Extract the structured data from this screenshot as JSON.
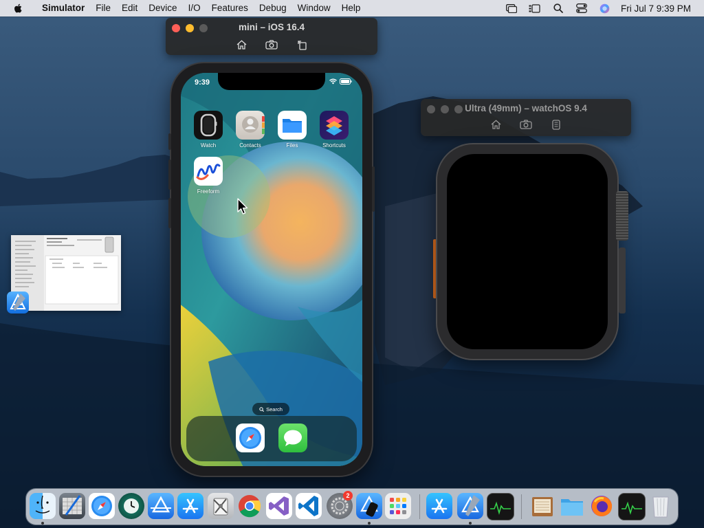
{
  "menubar": {
    "items": [
      "Simulator",
      "File",
      "Edit",
      "Device",
      "I/O",
      "Features",
      "Debug",
      "Window",
      "Help"
    ],
    "clock": "Fri Jul 7  9:39 PM"
  },
  "iphone_sim": {
    "title": "mini – iOS 16.4",
    "status_time": "9:39",
    "apps": [
      {
        "label": "Watch",
        "icon": "watch-app-icon"
      },
      {
        "label": "Contacts",
        "icon": "contacts-app-icon"
      },
      {
        "label": "Files",
        "icon": "files-app-icon"
      },
      {
        "label": "Shortcuts",
        "icon": "shortcuts-app-icon"
      },
      {
        "label": "Freeform",
        "icon": "freeform-app-icon"
      }
    ],
    "search_label": "Search",
    "dock": [
      "safari-icon",
      "messages-icon"
    ]
  },
  "watch_sim": {
    "title": "Ultra (49mm) – watchOS 9.4"
  },
  "dock": {
    "settings_badge": "2",
    "apps": [
      "finder",
      "xcode-instruments",
      "safari",
      "time-machine",
      "transporter",
      "app-store",
      "system-utility",
      "chrome",
      "visual-studio",
      "vs-code",
      "system-settings",
      "simulator",
      "launchpad",
      "app-store-2",
      "xcode",
      "activity-monitor",
      "archive-utility",
      "folder",
      "firefox",
      "activity-monitor-2",
      "trash"
    ]
  },
  "colors": {
    "close": "#ff5f57",
    "minimize": "#febc2e",
    "zoom_inactive": "#5a5a5a",
    "badge": "#f23a2f",
    "watch_action_button": "#e07020"
  }
}
